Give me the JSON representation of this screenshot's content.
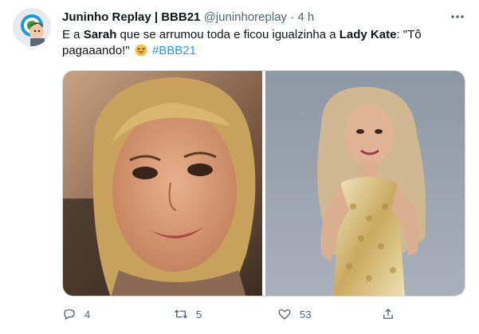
{
  "tweet": {
    "display_name": "Juninho Replay | BBB21",
    "handle": "@juninhoreplay",
    "separator": "·",
    "time": "4 h",
    "text_1": "E a ",
    "text_sarah": "Sarah",
    "text_2": " que se arrumou toda e ficou igualzinha a ",
    "text_lady": "Lady Kate",
    "text_3": ": \"Tô pagaaando!\" ",
    "hashtag": "#BBB21",
    "emoji_name": "grinning-squinting-face"
  },
  "actions": {
    "replies": "4",
    "retweets": "5",
    "likes": "53"
  },
  "icons": {
    "more": "more-icon",
    "reply": "reply-icon",
    "retweet": "retweet-icon",
    "like": "heart-icon",
    "share": "share-icon"
  },
  "colors": {
    "link": "#1d9bf0",
    "secondary_text": "#536471",
    "primary_text": "#0f1419"
  }
}
